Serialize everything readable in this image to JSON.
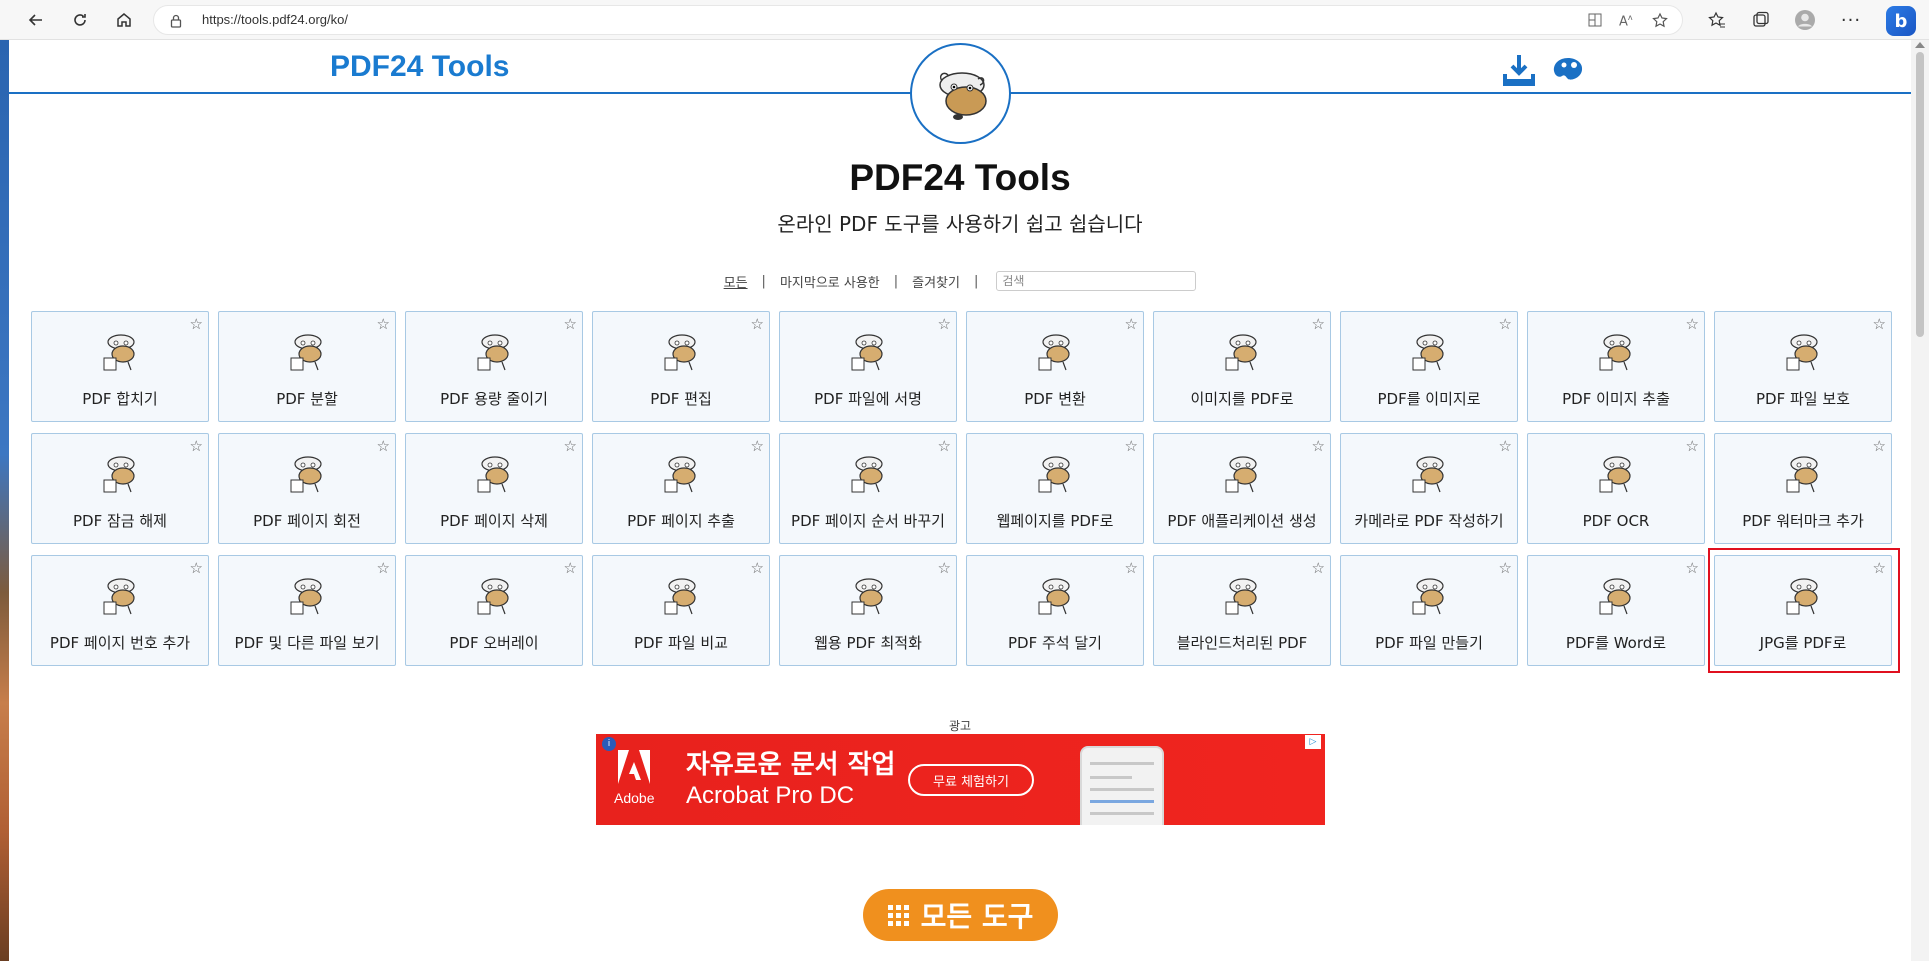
{
  "browser": {
    "url": "https://tools.pdf24.org/ko/"
  },
  "site": {
    "logo": "PDF24 Tools",
    "title": "PDF24 Tools",
    "subtitle": "온라인 PDF 도구를 사용하기 쉽고 쉽습니다"
  },
  "filters": {
    "all": "모든",
    "recent": "마지막으로 사용한",
    "favorites": "즐겨찾기",
    "search_placeholder": "검색"
  },
  "tools": [
    {
      "label": "PDF 합치기",
      "icon": "merge-icon"
    },
    {
      "label": "PDF 분할",
      "icon": "split-icon"
    },
    {
      "label": "PDF 용량 줄이기",
      "icon": "compress-icon"
    },
    {
      "label": "PDF 편집",
      "icon": "edit-icon"
    },
    {
      "label": "PDF 파일에 서명",
      "icon": "sign-icon"
    },
    {
      "label": "PDF 변환",
      "icon": "convert-icon"
    },
    {
      "label": "이미지를 PDF로",
      "icon": "images-to-pdf-icon"
    },
    {
      "label": "PDF를 이미지로",
      "icon": "pdf-to-images-icon"
    },
    {
      "label": "PDF 이미지 추출",
      "icon": "extract-images-icon"
    },
    {
      "label": "PDF 파일 보호",
      "icon": "protect-icon"
    },
    {
      "label": "PDF 잠금 해제",
      "icon": "unlock-icon"
    },
    {
      "label": "PDF 페이지 회전",
      "icon": "rotate-icon"
    },
    {
      "label": "PDF 페이지 삭제",
      "icon": "delete-pages-icon"
    },
    {
      "label": "PDF 페이지 추출",
      "icon": "extract-pages-icon"
    },
    {
      "label": "PDF 페이지 순서 바꾸기",
      "icon": "reorder-icon"
    },
    {
      "label": "웹페이지를 PDF로",
      "icon": "webpage-icon"
    },
    {
      "label": "PDF 애플리케이션 생성",
      "icon": "application-icon"
    },
    {
      "label": "카메라로 PDF 작성하기",
      "icon": "camera-icon"
    },
    {
      "label": "PDF OCR",
      "icon": "ocr-icon"
    },
    {
      "label": "PDF 워터마크 추가",
      "icon": "watermark-icon"
    },
    {
      "label": "PDF 페이지 번호 추가",
      "icon": "page-numbers-icon"
    },
    {
      "label": "PDF 및 다른 파일 보기",
      "icon": "viewer-icon"
    },
    {
      "label": "PDF 오버레이",
      "icon": "overlay-icon"
    },
    {
      "label": "PDF 파일 비교",
      "icon": "compare-icon"
    },
    {
      "label": "웹용 PDF 최적화",
      "icon": "optimize-icon"
    },
    {
      "label": "PDF 주석 달기",
      "icon": "annotate-icon"
    },
    {
      "label": "블라인드처리된 PDF",
      "icon": "redact-icon"
    },
    {
      "label": "PDF 파일 만들기",
      "icon": "create-icon"
    },
    {
      "label": "PDF를 Word로",
      "icon": "pdf-to-word-icon"
    },
    {
      "label": "JPG를 PDF로",
      "icon": "jpg-to-pdf-icon"
    }
  ],
  "ad": {
    "label": "광고",
    "brand": "Adobe",
    "headline": "자유로운 문서 작업",
    "product": "Acrobat Pro DC",
    "cta": "무료 체험하기"
  },
  "all_tools_button": "모든 도구",
  "colors": {
    "brand_blue": "#1a70c4",
    "tile_bg": "#f4f8fc",
    "tile_border": "#a8c9e4",
    "highlight_red": "#e0101f",
    "cta_orange": "#f0901e"
  }
}
